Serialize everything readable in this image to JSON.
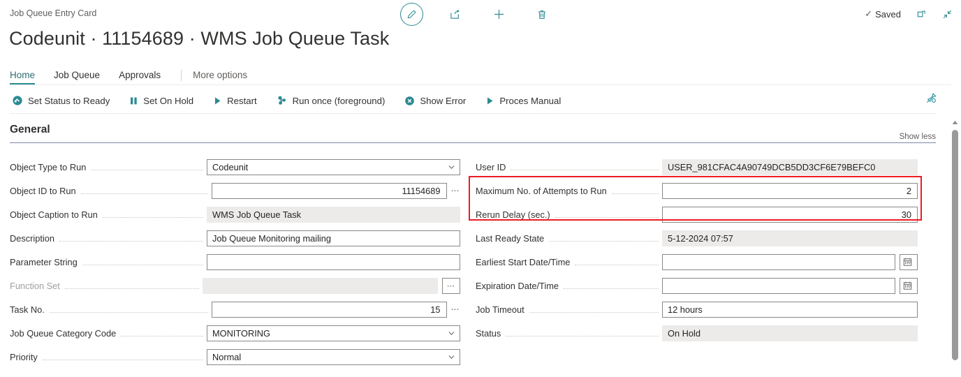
{
  "header": {
    "breadcrumb": "Job Queue Entry Card",
    "title": "Codeunit · 11154689 · WMS Job Queue Task",
    "center_icons": [
      {
        "name": "edit-pencil-icon",
        "label": "Edit"
      },
      {
        "name": "share-icon",
        "label": "Share"
      },
      {
        "name": "plus-icon",
        "label": "New"
      },
      {
        "name": "trash-icon",
        "label": "Delete"
      }
    ],
    "saved_label": "Saved",
    "open-new-window": "Open in new window",
    "minimize": "Collapse"
  },
  "tabs": [
    {
      "label": "Home",
      "active": true
    },
    {
      "label": "Job Queue",
      "active": false
    },
    {
      "label": "Approvals",
      "active": false
    },
    {
      "label": "More options",
      "active": false
    }
  ],
  "ribbon": {
    "commands": [
      {
        "label": "Set Status to Ready",
        "icon": "set-ready-icon"
      },
      {
        "label": "Set On Hold",
        "icon": "pause-icon"
      },
      {
        "label": "Restart",
        "icon": "play-icon"
      },
      {
        "label": "Run once (foreground)",
        "icon": "run-once-icon"
      },
      {
        "label": "Show Error",
        "icon": "error-circle-icon"
      },
      {
        "label": "Proces Manual",
        "icon": "play-icon"
      }
    ],
    "pin_label": "Unpin"
  },
  "general": {
    "title": "General",
    "show_less": "Show less",
    "left_fields": [
      {
        "label": "Object Type to Run",
        "value": "Codeunit",
        "type": "dropdown"
      },
      {
        "label": "Object ID to Run",
        "value": "11154689",
        "type": "number-lookup"
      },
      {
        "label": "Object Caption to Run",
        "value": "WMS Job Queue Task",
        "type": "readonly"
      },
      {
        "label": "Description",
        "value": "Job Queue Monitoring mailing",
        "type": "text"
      },
      {
        "label": "Parameter String",
        "value": "",
        "type": "text"
      },
      {
        "label": "Function Set",
        "value": "",
        "type": "readonly-lookup"
      },
      {
        "label": "Task No.",
        "value": "15",
        "type": "number-lookup"
      },
      {
        "label": "Job Queue Category Code",
        "value": "MONITORING",
        "type": "dropdown"
      },
      {
        "label": "Priority",
        "value": "Normal",
        "type": "dropdown"
      }
    ],
    "right_fields": [
      {
        "label": "User ID",
        "value": "USER_981CFAC4A90749DCB5DD3CF6E79BEFC0",
        "type": "readonly"
      },
      {
        "label": "Maximum No. of Attempts to Run",
        "value": "2",
        "type": "number"
      },
      {
        "label": "Rerun Delay (sec.)",
        "value": "30",
        "type": "number"
      },
      {
        "label": "Last Ready State",
        "value": "5-12-2024 07:57",
        "type": "readonly"
      },
      {
        "label": "Earliest Start Date/Time",
        "value": "",
        "type": "datetime"
      },
      {
        "label": "Expiration Date/Time",
        "value": "",
        "type": "datetime"
      },
      {
        "label": "Job Timeout",
        "value": "12 hours",
        "type": "text"
      },
      {
        "label": "Status",
        "value": "On Hold",
        "type": "readonly"
      }
    ]
  },
  "annotation": {
    "type": "red-rectangle-highlight",
    "color": "#ed1c24"
  },
  "colors": {
    "accent": "#2c8a92",
    "section_rule": "#7c8aa5",
    "readonly_bg": "#edebe9"
  }
}
